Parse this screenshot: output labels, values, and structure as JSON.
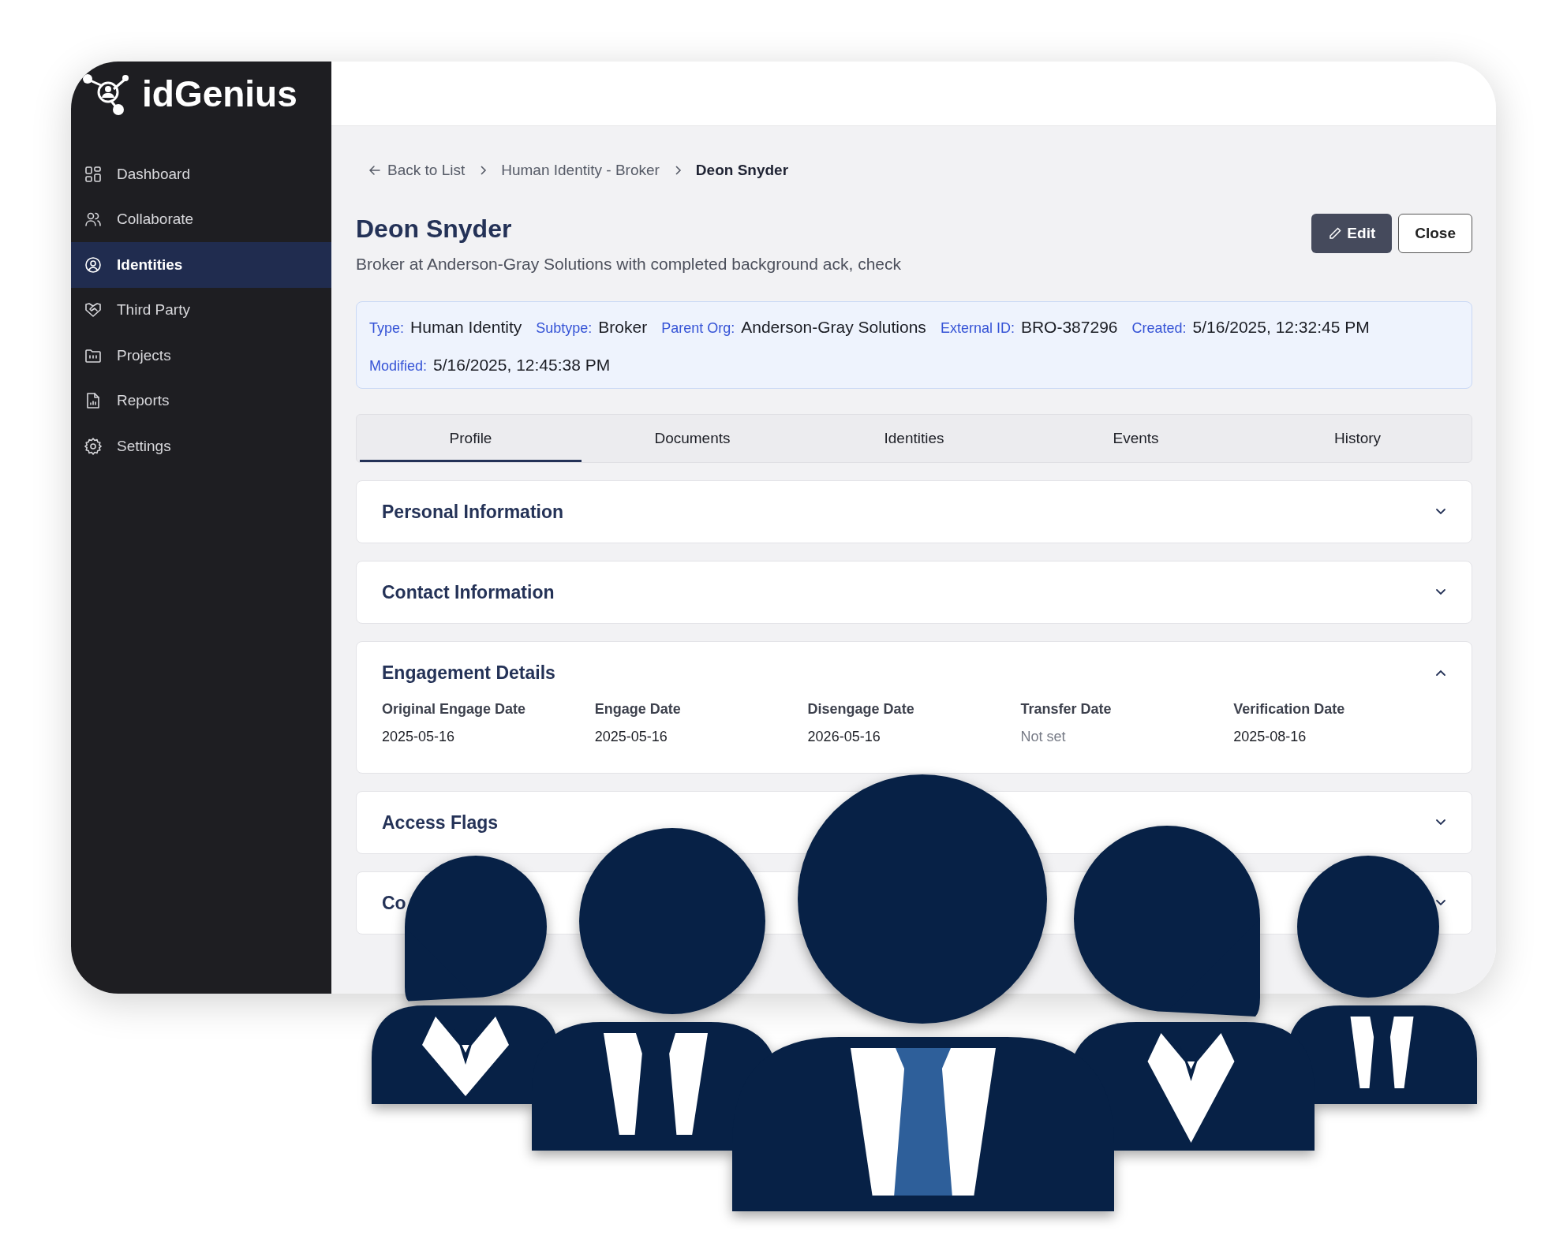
{
  "app": {
    "logo": "idGenius"
  },
  "sidebar": {
    "items": [
      {
        "label": "Dashboard",
        "selected": false
      },
      {
        "label": "Collaborate",
        "selected": false
      },
      {
        "label": "Identities",
        "selected": true
      },
      {
        "label": "Third Party",
        "selected": false
      },
      {
        "label": "Projects",
        "selected": false
      },
      {
        "label": "Reports",
        "selected": false
      },
      {
        "label": "Settings",
        "selected": false
      }
    ]
  },
  "breadcrumb": {
    "back": "Back to List",
    "items": [
      "Human Identity - Broker",
      "Deon Snyder"
    ]
  },
  "header": {
    "title": "Deon Snyder",
    "subtitle": "Broker at Anderson-Gray Solutions with completed background ack, check",
    "buttons": [
      "Edit",
      "Close"
    ]
  },
  "meta": [
    {
      "label": "Type:",
      "value": "Human Identity"
    },
    {
      "label": "Subtype:",
      "value": "Broker"
    },
    {
      "label": "Parent Org:",
      "value": "Anderson-Gray Solutions"
    },
    {
      "label": "External ID:",
      "value": "BRO-387296"
    },
    {
      "label": "Created:",
      "value": "5/16/2025, 12:32:45 PM"
    },
    {
      "label": "Modified:",
      "value": "5/16/2025, 12:45:38 PM"
    }
  ],
  "tabs": [
    {
      "label": "Profile",
      "selected": true
    },
    {
      "label": "Documents",
      "selected": false
    },
    {
      "label": "Identities",
      "selected": false
    },
    {
      "label": "Events",
      "selected": false
    },
    {
      "label": "History",
      "selected": false
    }
  ],
  "sections": [
    {
      "title": "Personal Information",
      "expanded": false
    },
    {
      "title": "Contact Information",
      "expanded": false
    },
    {
      "title": "Engagement Details",
      "expanded": true,
      "fields": [
        {
          "label": "Original Engage Date",
          "value": "2025-05-16",
          "is_set": true
        },
        {
          "label": "Engage Date",
          "value": "2025-05-16",
          "is_set": true
        },
        {
          "label": "Disengage Date",
          "value": "2026-05-16",
          "is_set": true
        },
        {
          "label": "Transfer Date",
          "value": "Not set",
          "is_set": false
        },
        {
          "label": "Verification Date",
          "value": "2025-08-16",
          "is_set": true
        }
      ]
    },
    {
      "title": "Access Flags",
      "expanded": false
    },
    {
      "title": "Co",
      "expanded": false
    }
  ]
}
